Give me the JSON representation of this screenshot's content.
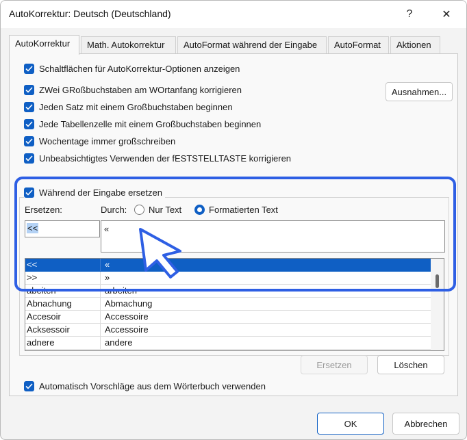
{
  "window": {
    "title": "AutoKorrektur: Deutsch (Deutschland)",
    "help_glyph": "?",
    "close_glyph": "✕"
  },
  "tabs": [
    {
      "label": "AutoKorrektur",
      "active": true
    },
    {
      "label": "Math. Autokorrektur"
    },
    {
      "label": "AutoFormat während der Eingabe"
    },
    {
      "label": "AutoFormat"
    },
    {
      "label": "Aktionen"
    }
  ],
  "options": {
    "show_buttons": "Schaltflächen für AutoKorrektur-Optionen anzeigen",
    "two_caps": "ZWei GRoßbuchstaben am WOrtanfang korrigieren",
    "sentence_cap": "Jeden Satz mit einem Großbuchstaben beginnen",
    "table_cell_cap": "Jede Tabellenzelle mit einem Großbuchstaben beginnen",
    "weekdays": "Wochentage immer großschreiben",
    "caps_lock": "Unbeabsichtigtes Verwenden der fESTSTELLTASTE korrigieren"
  },
  "exceptions_button": "Ausnahmen...",
  "replace_group": {
    "checkbox_label": "Während der Eingabe ersetzen",
    "replace_label": "Ersetzen:",
    "with_label": "Durch:",
    "radio_plain": "Nur Text",
    "radio_formatted": "Formatierten Text",
    "replace_value": "<<",
    "with_value": "«"
  },
  "entries": [
    {
      "from": "<<",
      "to": "«"
    },
    {
      "from": ">>",
      "to": "»"
    },
    {
      "from": "abeiten",
      "to": "arbeiten"
    },
    {
      "from": "Abnachung",
      "to": "Abmachung"
    },
    {
      "from": "Accesoir",
      "to": "Accessoire"
    },
    {
      "from": "Acksessoir",
      "to": "Accessoire"
    },
    {
      "from": "adnere",
      "to": "andere"
    }
  ],
  "actions": {
    "replace_button": "Ersetzen",
    "delete_button": "Löschen"
  },
  "dictionary_option": "Automatisch Vorschläge aus dem Wörterbuch verwenden",
  "footer": {
    "ok": "OK",
    "cancel": "Abbrechen"
  },
  "colors": {
    "accent": "#0f5fc4",
    "highlight": "#2e5fe4"
  }
}
